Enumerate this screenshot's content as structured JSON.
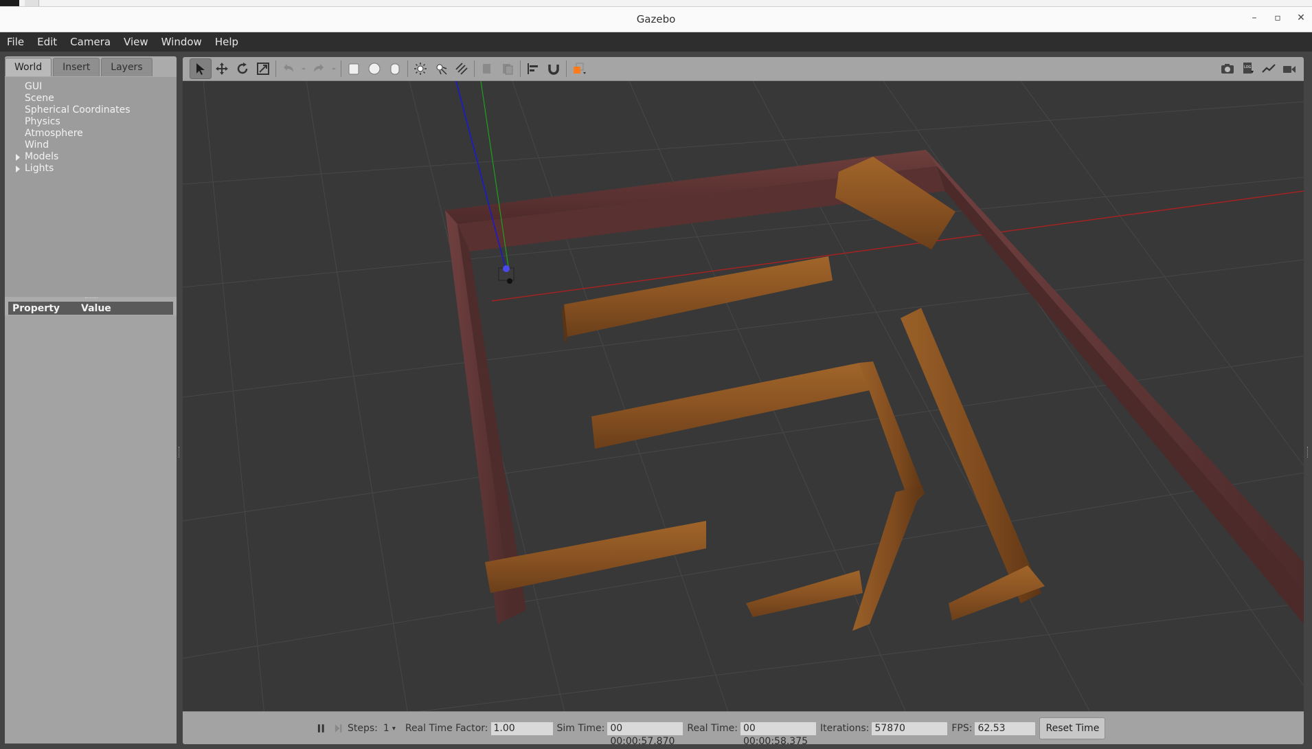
{
  "window": {
    "title": "Gazebo",
    "controls": [
      "minimize-icon",
      "restore-icon",
      "close-icon"
    ],
    "control_glyphs": [
      "–",
      "▫",
      "✕"
    ]
  },
  "menu": [
    "File",
    "Edit",
    "Camera",
    "View",
    "Window",
    "Help"
  ],
  "left_panel": {
    "tabs": [
      "World",
      "Insert",
      "Layers"
    ],
    "active_tab": "World",
    "tree": [
      "GUI",
      "Scene",
      "Spherical Coordinates",
      "Physics",
      "Atmosphere",
      "Wind",
      "Models",
      "Lights"
    ],
    "expandable": [
      "Models",
      "Lights"
    ],
    "property_header": {
      "property": "Property",
      "value": "Value"
    }
  },
  "toolbar": {
    "left_icons": [
      "select-arrow-icon",
      "translate-icon",
      "rotate-icon",
      "scale-icon",
      "undo-icon",
      "undo-dropdown-icon",
      "redo-icon",
      "redo-dropdown-icon",
      "box-icon",
      "sphere-icon",
      "cylinder-icon",
      "point-light-icon",
      "spot-light-icon",
      "directional-light-icon",
      "copy-icon",
      "paste-icon",
      "align-icon",
      "snap-icon",
      "view-angle-icon"
    ],
    "right_icons": [
      "screenshot-icon",
      "log-icon",
      "plot-icon",
      "video-record-icon"
    ]
  },
  "status": {
    "steps_label": "Steps:",
    "steps_value": "1",
    "rtf_label": "Real Time Factor:",
    "rtf_value": "1.00",
    "sim_label": "Sim Time:",
    "sim_value": "00 00:00:57.870",
    "real_label": "Real Time:",
    "real_value": "00 00:00:58.375",
    "iter_label": "Iterations:",
    "iter_value": "57870",
    "fps_label": "FPS:",
    "fps_value": "62.53",
    "reset_label": "Reset Time"
  },
  "colors": {
    "viewport_bg": "#383838",
    "grid": "#4a4a4a",
    "outer_wall": "#6a3a3a",
    "inner_wall": "#8a5a2a",
    "axis_x": "#b02020",
    "axis_y": "#20a020",
    "axis_z": "#1a1acc",
    "accent_orange": "#ff7a1a"
  }
}
